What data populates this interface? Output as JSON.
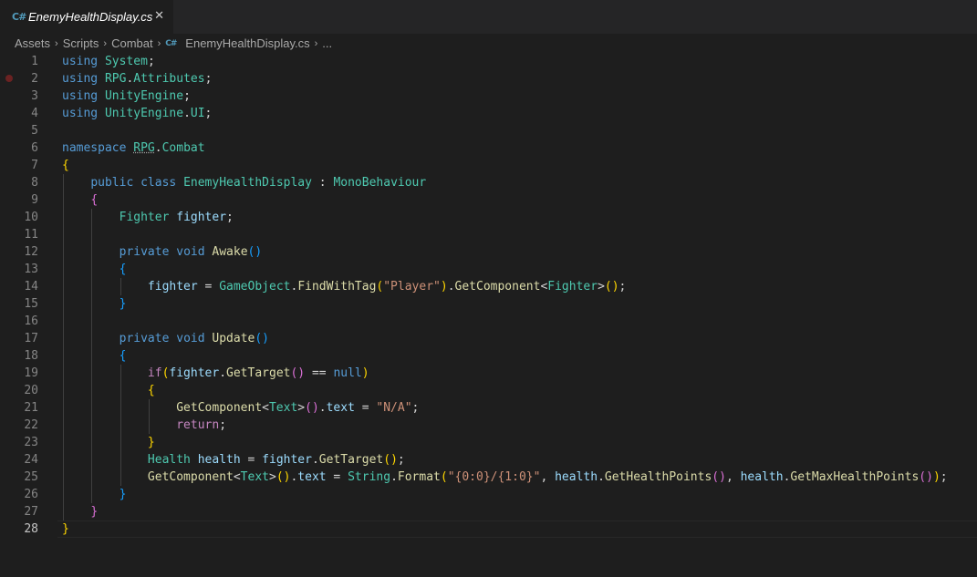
{
  "tab": {
    "title": "EnemyHealthDisplay.cs",
    "icon": "C#",
    "close": "✕"
  },
  "breadcrumb": {
    "items": [
      "Assets",
      "Scripts",
      "Combat"
    ],
    "file_icon": "C#",
    "file": "EnemyHealthDisplay.cs",
    "more": "..."
  },
  "editor": {
    "current_line": 28,
    "breakpoint_line": 2,
    "lines": [
      [
        [
          "kw",
          "using"
        ],
        [
          "pl",
          " "
        ],
        [
          "ty",
          "System"
        ],
        [
          "pl",
          ";"
        ]
      ],
      [
        [
          "kw",
          "using"
        ],
        [
          "pl",
          " "
        ],
        [
          "ty",
          "RPG"
        ],
        [
          "pl",
          "."
        ],
        [
          "ty",
          "Attributes"
        ],
        [
          "pl",
          ";"
        ]
      ],
      [
        [
          "kw",
          "using"
        ],
        [
          "pl",
          " "
        ],
        [
          "ty",
          "UnityEngine"
        ],
        [
          "pl",
          ";"
        ]
      ],
      [
        [
          "kw",
          "using"
        ],
        [
          "pl",
          " "
        ],
        [
          "ty",
          "UnityEngine"
        ],
        [
          "pl",
          "."
        ],
        [
          "ty",
          "UI"
        ],
        [
          "pl",
          ";"
        ]
      ],
      [],
      [
        [
          "kw",
          "namespace"
        ],
        [
          "pl",
          " "
        ],
        [
          "ty sq",
          "RPG"
        ],
        [
          "pl",
          "."
        ],
        [
          "ty",
          "Combat"
        ]
      ],
      [
        [
          "b1",
          "{"
        ]
      ],
      [
        [
          "pl",
          "    "
        ],
        [
          "kw",
          "public"
        ],
        [
          "pl",
          " "
        ],
        [
          "kw",
          "class"
        ],
        [
          "pl",
          " "
        ],
        [
          "ty",
          "EnemyHealthDisplay"
        ],
        [
          "pl",
          " : "
        ],
        [
          "ty",
          "MonoBehaviour"
        ]
      ],
      [
        [
          "pl",
          "    "
        ],
        [
          "b2",
          "{"
        ]
      ],
      [
        [
          "pl",
          "        "
        ],
        [
          "ty",
          "Fighter"
        ],
        [
          "pl",
          " "
        ],
        [
          "var",
          "fighter"
        ],
        [
          "pl",
          ";"
        ]
      ],
      [],
      [
        [
          "pl",
          "        "
        ],
        [
          "kw",
          "private"
        ],
        [
          "pl",
          " "
        ],
        [
          "kw",
          "void"
        ],
        [
          "pl",
          " "
        ],
        [
          "fn",
          "Awake"
        ],
        [
          "b3",
          "()"
        ]
      ],
      [
        [
          "pl",
          "        "
        ],
        [
          "b3",
          "{"
        ]
      ],
      [
        [
          "pl",
          "            "
        ],
        [
          "var",
          "fighter"
        ],
        [
          "pl",
          " = "
        ],
        [
          "ty",
          "GameObject"
        ],
        [
          "pl",
          "."
        ],
        [
          "fn",
          "FindWithTag"
        ],
        [
          "b1",
          "("
        ],
        [
          "str",
          "\"Player\""
        ],
        [
          "b1",
          ")"
        ],
        [
          "pl",
          "."
        ],
        [
          "fn",
          "GetComponent"
        ],
        [
          "pl",
          "<"
        ],
        [
          "ty",
          "Fighter"
        ],
        [
          "pl",
          ">"
        ],
        [
          "b1",
          "()"
        ],
        [
          "pl",
          ";"
        ]
      ],
      [
        [
          "pl",
          "        "
        ],
        [
          "b3",
          "}"
        ]
      ],
      [],
      [
        [
          "pl",
          "        "
        ],
        [
          "kw",
          "private"
        ],
        [
          "pl",
          " "
        ],
        [
          "kw",
          "void"
        ],
        [
          "pl",
          " "
        ],
        [
          "fn",
          "Update"
        ],
        [
          "b3",
          "()"
        ]
      ],
      [
        [
          "pl",
          "        "
        ],
        [
          "b3",
          "{"
        ]
      ],
      [
        [
          "pl",
          "            "
        ],
        [
          "ctl",
          "if"
        ],
        [
          "b1",
          "("
        ],
        [
          "var",
          "fighter"
        ],
        [
          "pl",
          "."
        ],
        [
          "fn",
          "GetTarget"
        ],
        [
          "b2",
          "()"
        ],
        [
          "pl",
          " == "
        ],
        [
          "kw",
          "null"
        ],
        [
          "b1",
          ")"
        ]
      ],
      [
        [
          "pl",
          "            "
        ],
        [
          "b1",
          "{"
        ]
      ],
      [
        [
          "pl",
          "                "
        ],
        [
          "fn",
          "GetComponent"
        ],
        [
          "pl",
          "<"
        ],
        [
          "ty",
          "Text"
        ],
        [
          "pl",
          ">"
        ],
        [
          "b2",
          "()"
        ],
        [
          "pl",
          "."
        ],
        [
          "var",
          "text"
        ],
        [
          "pl",
          " = "
        ],
        [
          "str",
          "\"N/A\""
        ],
        [
          "pl",
          ";"
        ]
      ],
      [
        [
          "pl",
          "                "
        ],
        [
          "ctl",
          "return"
        ],
        [
          "pl",
          ";"
        ]
      ],
      [
        [
          "pl",
          "            "
        ],
        [
          "b1",
          "}"
        ]
      ],
      [
        [
          "pl",
          "            "
        ],
        [
          "ty",
          "Health"
        ],
        [
          "pl",
          " "
        ],
        [
          "var",
          "health"
        ],
        [
          "pl",
          " = "
        ],
        [
          "var",
          "fighter"
        ],
        [
          "pl",
          "."
        ],
        [
          "fn",
          "GetTarget"
        ],
        [
          "b1",
          "()"
        ],
        [
          "pl",
          ";"
        ]
      ],
      [
        [
          "pl",
          "            "
        ],
        [
          "fn",
          "GetComponent"
        ],
        [
          "pl",
          "<"
        ],
        [
          "ty",
          "Text"
        ],
        [
          "pl",
          ">"
        ],
        [
          "b1",
          "()"
        ],
        [
          "pl",
          "."
        ],
        [
          "var",
          "text"
        ],
        [
          "pl",
          " = "
        ],
        [
          "ty",
          "String"
        ],
        [
          "pl",
          "."
        ],
        [
          "fn",
          "Format"
        ],
        [
          "b1",
          "("
        ],
        [
          "str",
          "\"{0:0}/{1:0}\""
        ],
        [
          "pl",
          ", "
        ],
        [
          "var",
          "health"
        ],
        [
          "pl",
          "."
        ],
        [
          "fn",
          "GetHealthPoints"
        ],
        [
          "b2",
          "()"
        ],
        [
          "pl",
          ", "
        ],
        [
          "var",
          "health"
        ],
        [
          "pl",
          "."
        ],
        [
          "fn",
          "GetMaxHealthPoints"
        ],
        [
          "b2",
          "()"
        ],
        [
          "b1",
          ")"
        ],
        [
          "pl",
          ";"
        ]
      ],
      [
        [
          "pl",
          "        "
        ],
        [
          "b3",
          "}"
        ]
      ],
      [
        [
          "pl",
          "    "
        ],
        [
          "b2",
          "}"
        ]
      ],
      [
        [
          "b1",
          "}"
        ]
      ]
    ]
  }
}
